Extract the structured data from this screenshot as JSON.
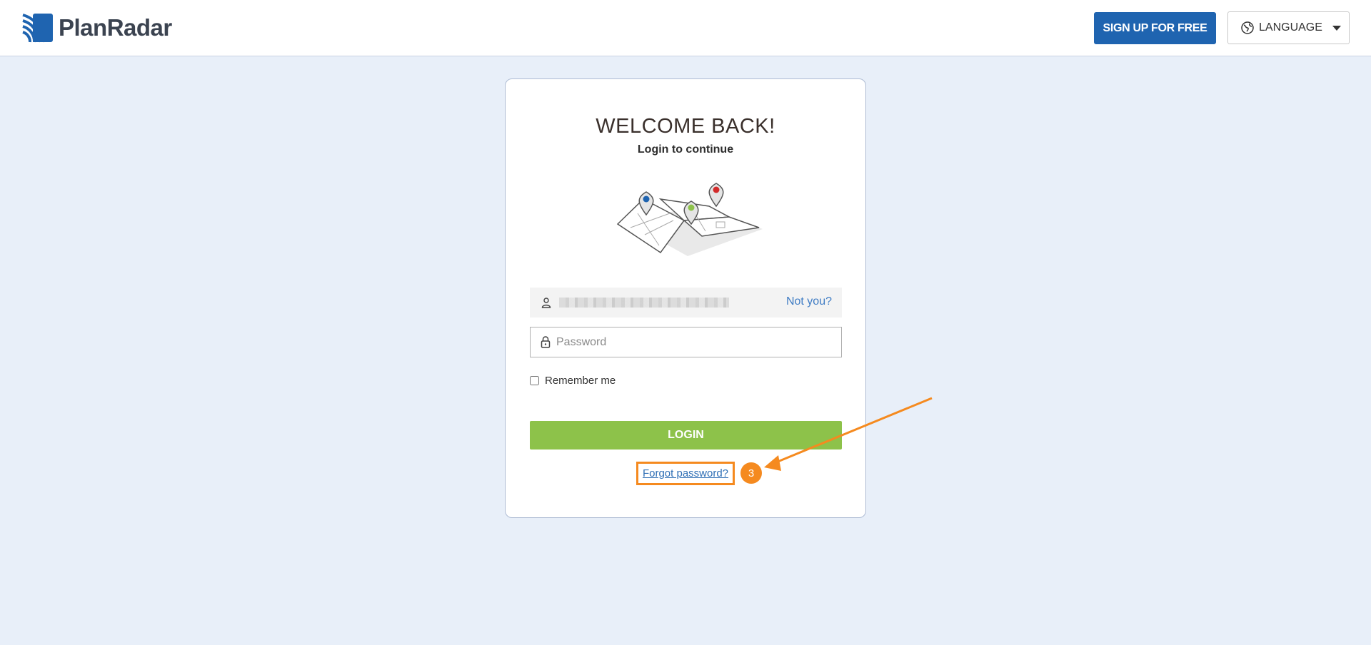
{
  "header": {
    "logo_text": "PlanRadar",
    "signup_label": "SIGN UP FOR FREE",
    "language_label": "LANGUAGE"
  },
  "card": {
    "title": "WELCOME BACK!",
    "subtitle": "Login to continue",
    "not_you": "Not you?",
    "password_placeholder": "Password",
    "remember_label": "Remember me",
    "login_label": "LOGIN",
    "forgot_label": "Forgot password?"
  },
  "annotation": {
    "step_number": "3"
  },
  "colors": {
    "brand_blue": "#1f64b0",
    "login_green": "#8dc24a",
    "annotation_orange": "#f58a1f",
    "page_bg": "#e8eff9"
  }
}
